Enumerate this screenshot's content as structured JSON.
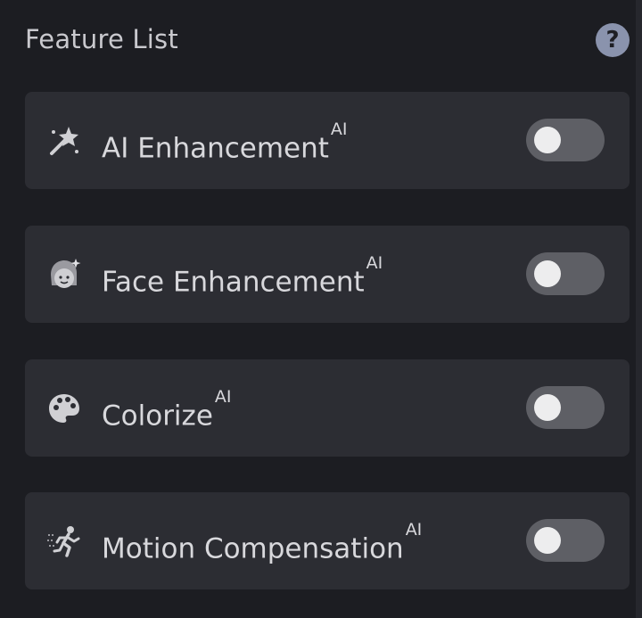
{
  "panel": {
    "title": "Feature List",
    "help_icon": "help-icon",
    "help_symbol": "?"
  },
  "features": [
    {
      "label": "AI Enhancement",
      "badge": "AI",
      "icon": "magic-wand-icon",
      "enabled": false
    },
    {
      "label": "Face Enhancement",
      "badge": "AI",
      "icon": "face-enhance-icon",
      "enabled": false
    },
    {
      "label": "Colorize",
      "badge": "AI",
      "icon": "palette-icon",
      "enabled": false
    },
    {
      "label": "Motion Compensation",
      "badge": "AI",
      "icon": "running-figure-icon",
      "enabled": false
    }
  ],
  "colors": {
    "background": "#1c1d22",
    "card": "#2c2d33",
    "toggle_off": "#5e5f65",
    "help_icon": "#8a93ad"
  }
}
